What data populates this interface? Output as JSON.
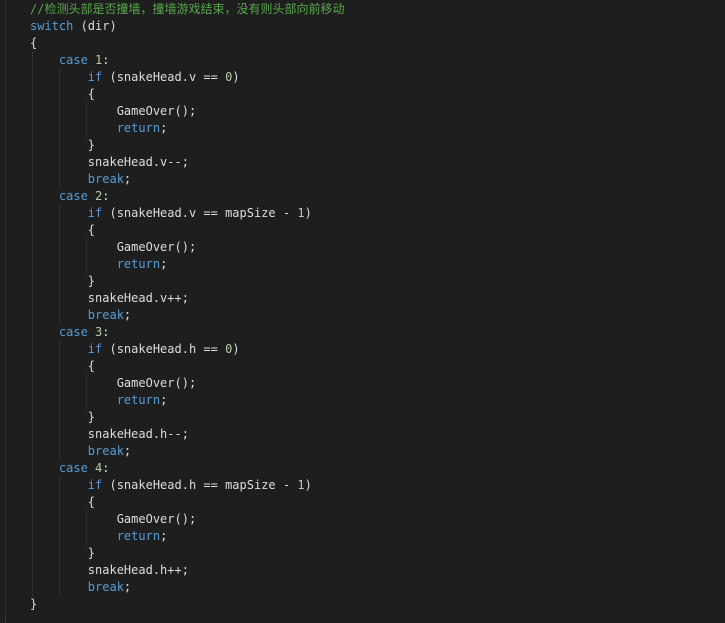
{
  "editor": {
    "colors": {
      "background": "#1e1e1e",
      "keyword": "#569cd6",
      "comment": "#57a64a",
      "number": "#b5cea8",
      "text": "#dcdcdc"
    },
    "lines": [
      {
        "indent": 0,
        "tokens": [
          {
            "t": "//检测头部是否撞墙，撞墙游戏结束，没有则头部向前移动",
            "c": "cm"
          }
        ]
      },
      {
        "indent": 0,
        "tokens": [
          {
            "t": "switch",
            "c": "kw"
          },
          {
            "t": " (dir)",
            "c": ""
          }
        ]
      },
      {
        "indent": 0,
        "tokens": [
          {
            "t": "{",
            "c": ""
          }
        ]
      },
      {
        "indent": 4,
        "tokens": [
          {
            "t": "case",
            "c": "kw"
          },
          {
            "t": " ",
            "c": ""
          },
          {
            "t": "1",
            "c": "num"
          },
          {
            "t": ":",
            "c": ""
          }
        ]
      },
      {
        "indent": 8,
        "tokens": [
          {
            "t": "if",
            "c": "kw"
          },
          {
            "t": " (snakeHead.v == ",
            "c": ""
          },
          {
            "t": "0",
            "c": "num"
          },
          {
            "t": ")",
            "c": ""
          }
        ]
      },
      {
        "indent": 8,
        "tokens": [
          {
            "t": "{",
            "c": ""
          }
        ]
      },
      {
        "indent": 12,
        "tokens": [
          {
            "t": "GameOver();",
            "c": ""
          }
        ]
      },
      {
        "indent": 12,
        "tokens": [
          {
            "t": "return",
            "c": "kw"
          },
          {
            "t": ";",
            "c": ""
          }
        ]
      },
      {
        "indent": 8,
        "tokens": [
          {
            "t": "}",
            "c": ""
          }
        ]
      },
      {
        "indent": 8,
        "tokens": [
          {
            "t": "snakeHead.v--;",
            "c": ""
          }
        ]
      },
      {
        "indent": 8,
        "tokens": [
          {
            "t": "break",
            "c": "kw"
          },
          {
            "t": ";",
            "c": ""
          }
        ]
      },
      {
        "indent": 4,
        "tokens": [
          {
            "t": "case",
            "c": "kw"
          },
          {
            "t": " ",
            "c": ""
          },
          {
            "t": "2",
            "c": "num"
          },
          {
            "t": ":",
            "c": ""
          }
        ]
      },
      {
        "indent": 8,
        "tokens": [
          {
            "t": "if",
            "c": "kw"
          },
          {
            "t": " (snakeHead.v == mapSize - ",
            "c": ""
          },
          {
            "t": "1",
            "c": "num"
          },
          {
            "t": ")",
            "c": ""
          }
        ]
      },
      {
        "indent": 8,
        "tokens": [
          {
            "t": "{",
            "c": ""
          }
        ]
      },
      {
        "indent": 12,
        "tokens": [
          {
            "t": "GameOver();",
            "c": ""
          }
        ]
      },
      {
        "indent": 12,
        "tokens": [
          {
            "t": "return",
            "c": "kw"
          },
          {
            "t": ";",
            "c": ""
          }
        ]
      },
      {
        "indent": 8,
        "tokens": [
          {
            "t": "}",
            "c": ""
          }
        ]
      },
      {
        "indent": 8,
        "tokens": [
          {
            "t": "snakeHead.v++;",
            "c": ""
          }
        ]
      },
      {
        "indent": 8,
        "tokens": [
          {
            "t": "break",
            "c": "kw"
          },
          {
            "t": ";",
            "c": ""
          }
        ]
      },
      {
        "indent": 4,
        "tokens": [
          {
            "t": "case",
            "c": "kw"
          },
          {
            "t": " ",
            "c": ""
          },
          {
            "t": "3",
            "c": "num"
          },
          {
            "t": ":",
            "c": ""
          }
        ]
      },
      {
        "indent": 8,
        "tokens": [
          {
            "t": "if",
            "c": "kw"
          },
          {
            "t": " (snakeHead.h == ",
            "c": ""
          },
          {
            "t": "0",
            "c": "num"
          },
          {
            "t": ")",
            "c": ""
          }
        ]
      },
      {
        "indent": 8,
        "tokens": [
          {
            "t": "{",
            "c": ""
          }
        ]
      },
      {
        "indent": 12,
        "tokens": [
          {
            "t": "GameOver();",
            "c": ""
          }
        ]
      },
      {
        "indent": 12,
        "tokens": [
          {
            "t": "return",
            "c": "kw"
          },
          {
            "t": ";",
            "c": ""
          }
        ]
      },
      {
        "indent": 8,
        "tokens": [
          {
            "t": "}",
            "c": ""
          }
        ]
      },
      {
        "indent": 8,
        "tokens": [
          {
            "t": "snakeHead.h--;",
            "c": ""
          }
        ]
      },
      {
        "indent": 8,
        "tokens": [
          {
            "t": "break",
            "c": "kw"
          },
          {
            "t": ";",
            "c": ""
          }
        ]
      },
      {
        "indent": 4,
        "tokens": [
          {
            "t": "case",
            "c": "kw"
          },
          {
            "t": " ",
            "c": ""
          },
          {
            "t": "4",
            "c": "num"
          },
          {
            "t": ":",
            "c": ""
          }
        ]
      },
      {
        "indent": 8,
        "tokens": [
          {
            "t": "if",
            "c": "kw"
          },
          {
            "t": " (snakeHead.h == mapSize - ",
            "c": ""
          },
          {
            "t": "1",
            "c": "num"
          },
          {
            "t": ")",
            "c": ""
          }
        ]
      },
      {
        "indent": 8,
        "tokens": [
          {
            "t": "{",
            "c": ""
          }
        ]
      },
      {
        "indent": 12,
        "tokens": [
          {
            "t": "GameOver();",
            "c": ""
          }
        ]
      },
      {
        "indent": 12,
        "tokens": [
          {
            "t": "return",
            "c": "kw"
          },
          {
            "t": ";",
            "c": ""
          }
        ]
      },
      {
        "indent": 8,
        "tokens": [
          {
            "t": "}",
            "c": ""
          }
        ]
      },
      {
        "indent": 8,
        "tokens": [
          {
            "t": "snakeHead.h++;",
            "c": ""
          }
        ]
      },
      {
        "indent": 8,
        "tokens": [
          {
            "t": "break",
            "c": "kw"
          },
          {
            "t": ";",
            "c": ""
          }
        ]
      },
      {
        "indent": 0,
        "tokens": [
          {
            "t": "}",
            "c": ""
          }
        ]
      }
    ]
  }
}
